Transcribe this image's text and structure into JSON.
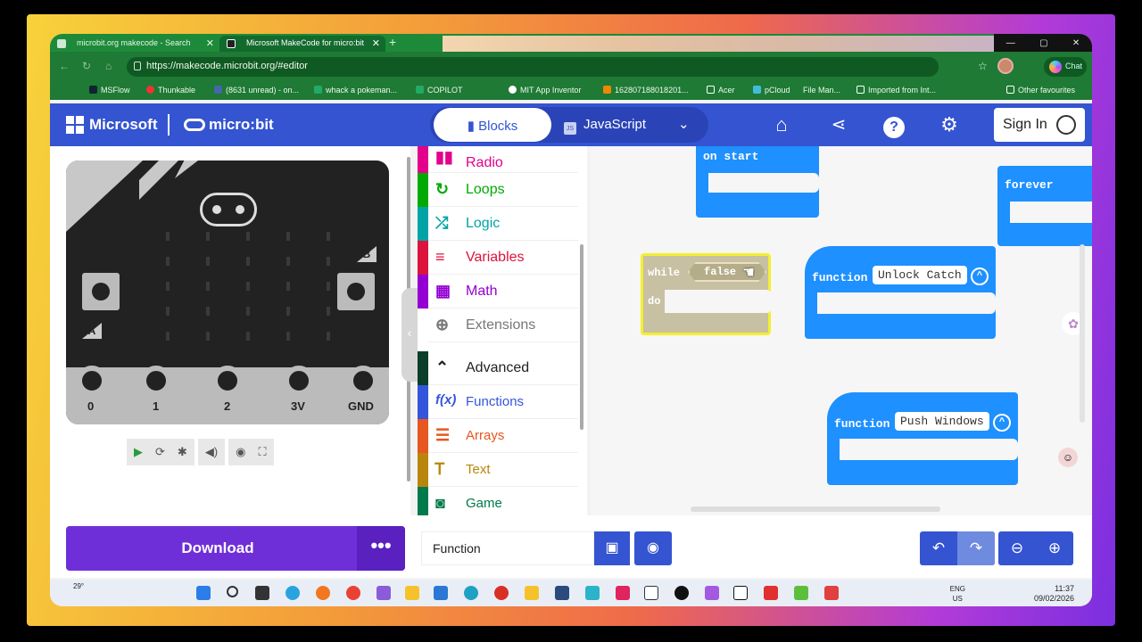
{
  "browser": {
    "tabs": [
      {
        "title": "microbit.org makecode - Search"
      },
      {
        "title": "Microsoft MakeCode for micro:bit"
      }
    ],
    "url": "https://makecode.microbit.org/#editor",
    "chat_label": "Chat",
    "bookmarks": [
      "MSFlow",
      "Thunkable",
      "(8631 unread) - on...",
      "whack a pokeman...",
      "COPILOT",
      "MIT App Inventor",
      "162807188018201...",
      "Acer",
      "pCloud",
      "File Man...",
      "Imported from Int...",
      "Other favourites"
    ]
  },
  "header": {
    "brand": "Microsoft",
    "product": "micro:bit",
    "blocks_label": "Blocks",
    "js_label": "JavaScript",
    "sign_in": "Sign In",
    "icons": [
      "home-icon",
      "share-icon",
      "help-icon",
      "settings-icon"
    ]
  },
  "simulator": {
    "pins": [
      "0",
      "1",
      "2",
      "3V",
      "GND"
    ],
    "buttons": [
      "A",
      "B"
    ]
  },
  "toolbox": {
    "categories": [
      {
        "label": "Radio",
        "color": "#e3008c",
        "icon": "radio-icon"
      },
      {
        "label": "Loops",
        "color": "#00aa00",
        "icon": "loops-icon"
      },
      {
        "label": "Logic",
        "color": "#00a4a6",
        "icon": "logic-icon"
      },
      {
        "label": "Variables",
        "color": "#dc143c",
        "icon": "variables-icon"
      },
      {
        "label": "Math",
        "color": "#9400d3",
        "icon": "math-icon"
      },
      {
        "label": "Extensions",
        "color": "#777777",
        "icon": "extensions-icon"
      },
      {
        "label": "Advanced",
        "color": "#222222",
        "icon": "chevron-up-icon"
      },
      {
        "label": "Functions",
        "color": "#3455db",
        "icon": "functions-icon"
      },
      {
        "label": "Arrays",
        "color": "#e65722",
        "icon": "arrays-icon"
      },
      {
        "label": "Text",
        "color": "#b8860b",
        "icon": "text-icon"
      },
      {
        "label": "Game",
        "color": "#007a4b",
        "icon": "game-icon"
      }
    ]
  },
  "workspace": {
    "on_start": "on start",
    "forever": "forever",
    "while_kw": "while",
    "while_cond": "false",
    "do_kw": "do",
    "function_kw": "function",
    "fn1_name": "Unlock Catch",
    "fn2_name": "Push Windows"
  },
  "bottom": {
    "download": "Download",
    "more": "•••",
    "project_name": "Function"
  },
  "taskbar": {
    "weather": "29°",
    "lang1": "ENG",
    "lang2": "US",
    "time": "11:37",
    "date": "09/02/2026"
  }
}
